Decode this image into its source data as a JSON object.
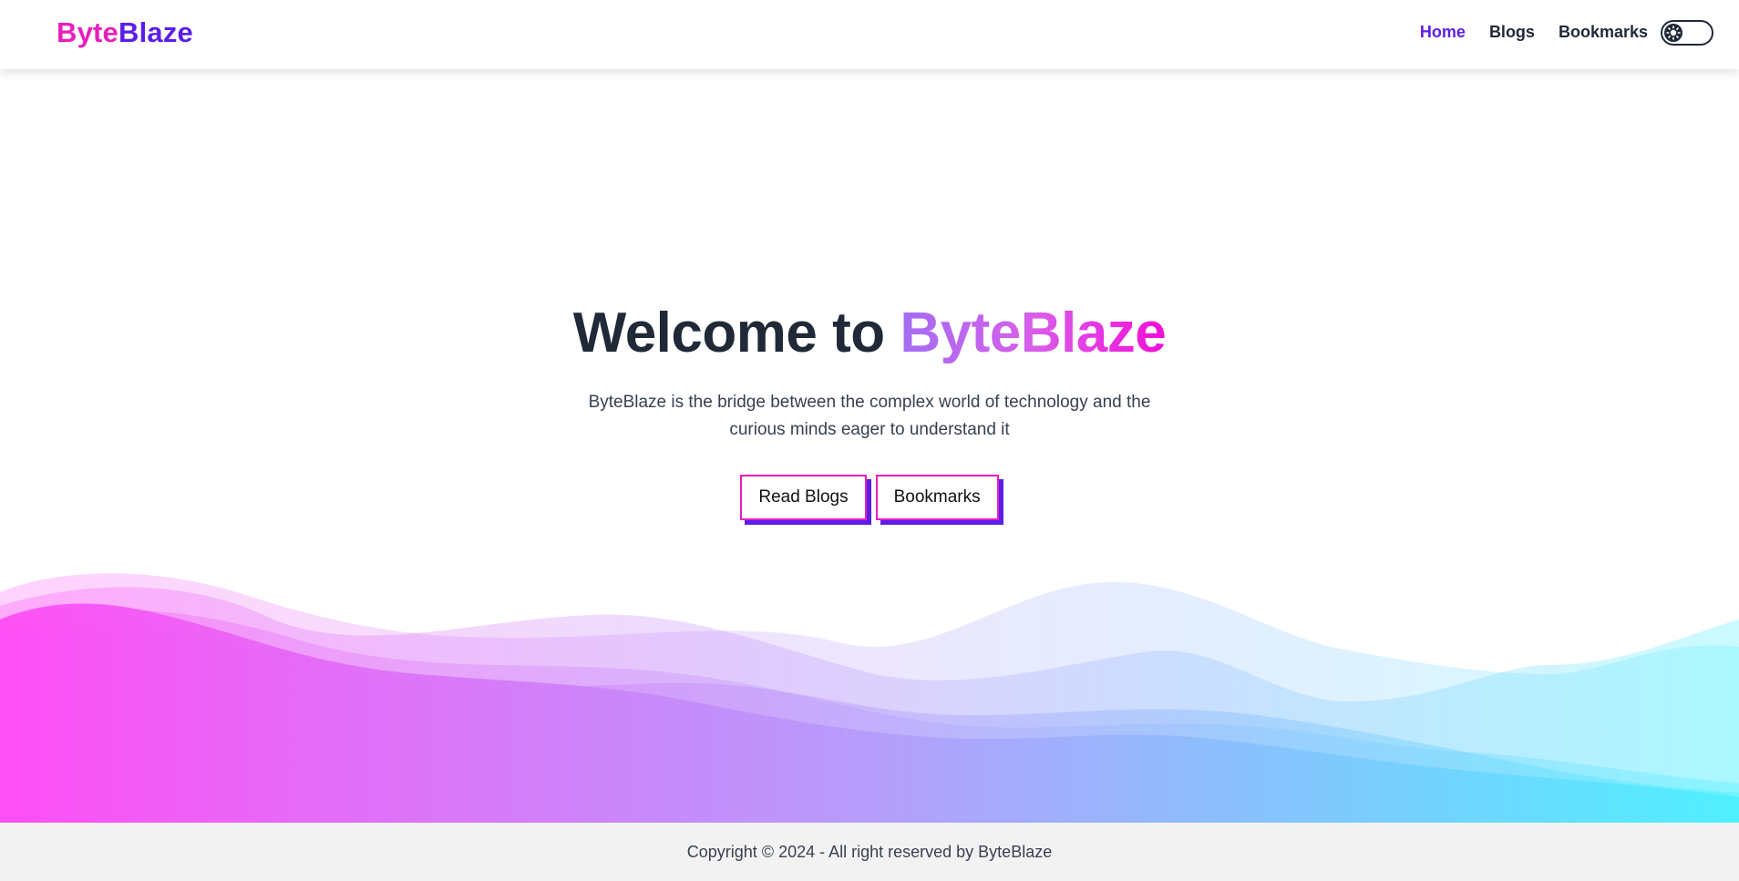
{
  "navbar": {
    "logo_part1": "Byte",
    "logo_part2": "Blaze",
    "links": [
      {
        "label": "Home",
        "active": true
      },
      {
        "label": "Blogs",
        "active": false
      },
      {
        "label": "Bookmarks",
        "active": false
      }
    ],
    "theme_toggle_icon": "sun-icon"
  },
  "hero": {
    "title_prefix": "Welcome to ",
    "title_brand": "ByteBlaze",
    "subtitle": "ByteBlaze is the bridge between the complex world of technology and the curious minds eager to understand it",
    "buttons": {
      "read_blogs": "Read Blogs",
      "bookmarks": "Bookmarks"
    }
  },
  "footer": {
    "copyright": "Copyright © 2024 - All right reserved by ByteBlaze"
  },
  "colors": {
    "primary_pink": "#e91ebd",
    "primary_purple": "#5b1ee8",
    "text_dark": "#1f2937",
    "wave_start": "#ff4df5",
    "wave_end": "#4df0ff",
    "footer_bg": "#f2f2f2"
  }
}
